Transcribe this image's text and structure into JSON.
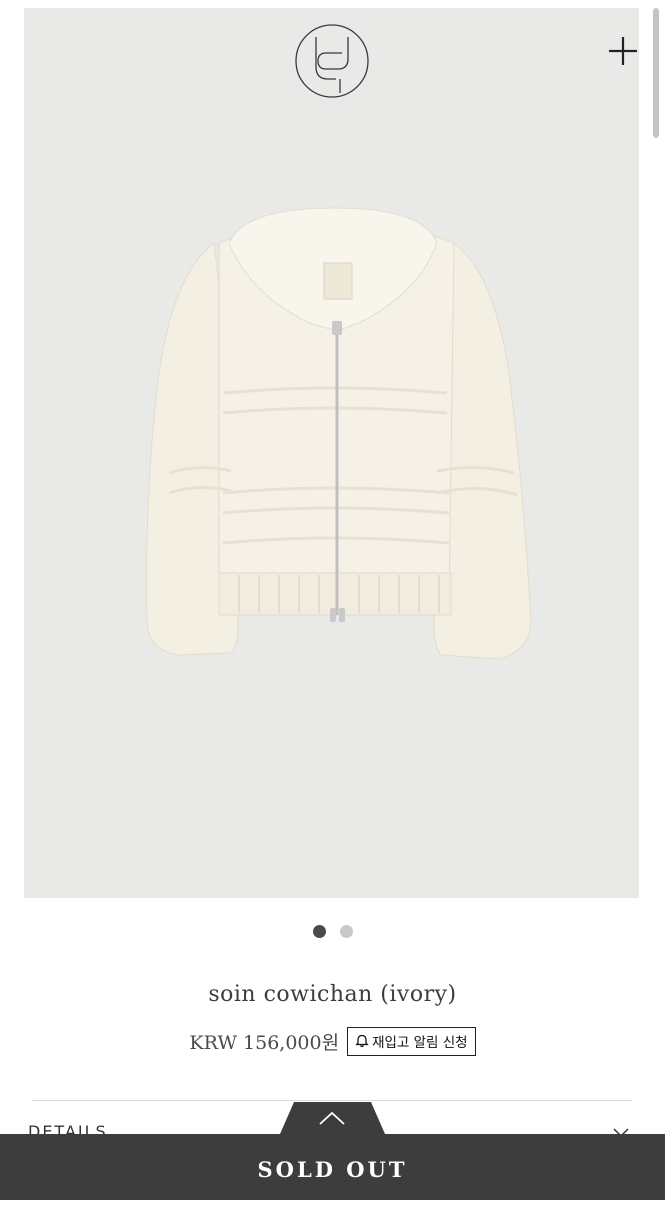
{
  "product": {
    "name": "soin cowichan (ivory)",
    "price": "KRW 156,000원",
    "restock_label": "재입고 알림 신청"
  },
  "gallery": {
    "slide_count": 2,
    "active_index": 0
  },
  "details": {
    "label": "DETAILS"
  },
  "footer": {
    "sold_out_label": "SOLD OUT"
  },
  "colors": {
    "hero_bg": "#e9e9e8",
    "sold_out_bar": "#3d3d3d",
    "dot_active": "#4a4a4a",
    "dot_inactive": "#c8c8c8"
  },
  "icons": [
    "brand-logo-icon",
    "plus-icon",
    "bell-icon",
    "chevron-up-icon",
    "chevron-down-icon"
  ]
}
